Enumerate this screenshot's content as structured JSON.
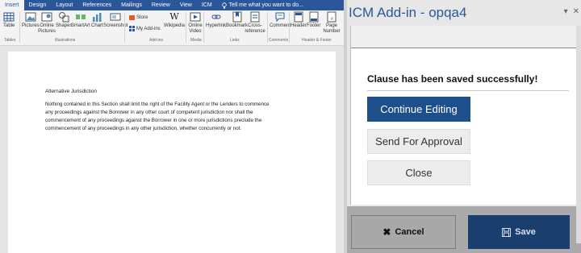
{
  "ribbon": {
    "tabs": [
      "Insert",
      "Design",
      "Layout",
      "References",
      "Mailings",
      "Review",
      "View",
      "ICM"
    ],
    "tell_me": "Tell me what you want to do...",
    "buttons": {
      "table": "Table",
      "pictures": "Pictures",
      "online_pictures": "Online Pictures",
      "shapes": "Shapes",
      "smartart": "SmartArt",
      "chart": "Chart",
      "screenshot": "Screenshot",
      "store": "Store",
      "my_addins": "My Add-ins",
      "wikipedia": "Wikipedia",
      "online_video": "Online Video",
      "hyperlink": "Hyperlink",
      "bookmark": "Bookmark",
      "cross_reference": "Cross-reference",
      "comment": "Comment",
      "header": "Header",
      "footer": "Footer",
      "page_number": "Page Number"
    },
    "groups": {
      "tables": "Tables",
      "illustrations": "Illustrations",
      "addins": "Add-ins",
      "media": "Media",
      "links": "Links",
      "comments": "Comments",
      "header_footer": "Header & Footer"
    }
  },
  "document": {
    "heading": "Alternative Jurisdiction",
    "lines": [
      "Nothing contained in this Section shall limit the right of the Facility Agent or the Lenders to commence",
      "any proceedings against the Borrower in any other court of competent jurisdiction nor shall the",
      "commencement of any proceedings against the Borrower in one or more jurisdictions preclude the",
      "commencement of any proceedings in any other jurisdiction, whether concurrently or not."
    ]
  },
  "panel": {
    "title": "ICM Add-in - opqa4",
    "message": "Clause has been saved successfully!",
    "continue_label": "Continue Editing",
    "approval_label": "Send For Approval",
    "close_label": "Close",
    "cancel_label": "Cancel",
    "save_label": "Save"
  },
  "colors": {
    "ribbon_blue": "#2b579a",
    "primary_button": "#1d4f8b",
    "save_button": "#1a3f6e"
  }
}
